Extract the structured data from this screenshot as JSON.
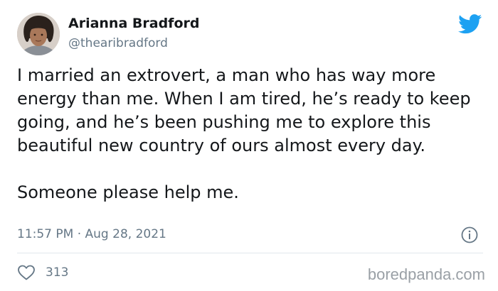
{
  "author": {
    "name": "Arianna Bradford",
    "handle": "@thearibradford",
    "avatar_icon": "profile-photo"
  },
  "tweet": {
    "paragraphs": [
      "I married an extrovert, a man who has way more energy than me. When I am tired, he’s ready to keep going, and he’s been pushing me to explore this beautiful new country of ours almost every day.",
      "Someone please help me."
    ],
    "timestamp": "11:57 PM · Aug 28, 2021"
  },
  "engagement": {
    "likes": "313",
    "like_icon": "heart-icon"
  },
  "icons": {
    "brand": "twitter-bird-icon",
    "info": "info-icon"
  },
  "watermark": "boredpanda.com",
  "colors": {
    "twitter_blue": "#1da1f2",
    "secondary_text": "#657786",
    "primary_text": "#14171a",
    "divider": "#e1e8ed"
  }
}
